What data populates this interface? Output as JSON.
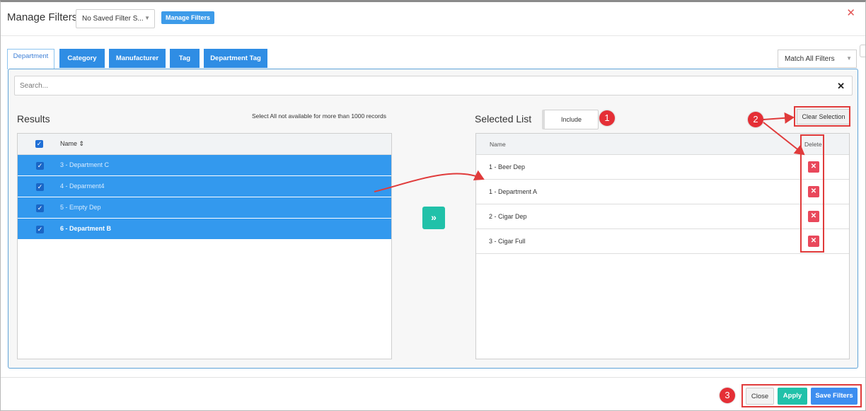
{
  "header": {
    "title": "Manage Filters",
    "saved_filter_value": "No Saved Filter S...",
    "manage_filters_label": "Manage Filters",
    "close_glyph": "✕"
  },
  "tabs": [
    {
      "label": "Department",
      "active": true
    },
    {
      "label": "Category",
      "active": false
    },
    {
      "label": "Manufacturer",
      "active": false
    },
    {
      "label": "Tag",
      "active": false
    },
    {
      "label": "Department Tag",
      "active": false
    }
  ],
  "match_select": {
    "value": "Match All Filters"
  },
  "search": {
    "placeholder": "Search...",
    "clear_glyph": "✕"
  },
  "results": {
    "title": "Results",
    "note": "Select All not available for more than 1000 records",
    "column_name": "Name",
    "rows": [
      {
        "label": "3 - Department C",
        "checked": true
      },
      {
        "label": "4 - Deparment4",
        "checked": true
      },
      {
        "label": "5 - Empty Dep",
        "checked": true
      },
      {
        "label": "6 - Department B",
        "checked": true
      }
    ]
  },
  "move_button": {
    "glyph": "»"
  },
  "selected": {
    "title": "Selected List",
    "include_label": "Include",
    "clear_label": "Clear Selection",
    "column_name": "Name",
    "column_delete": "Delete",
    "rows": [
      {
        "label": "1 - Beer Dep"
      },
      {
        "label": "1 - Department A"
      },
      {
        "label": "2 - Cigar Dep"
      },
      {
        "label": "3 - Cigar Full"
      }
    ]
  },
  "footer": {
    "close_label": "Close",
    "apply_label": "Apply",
    "save_label": "Save Filters"
  },
  "annotations": {
    "badges": [
      "1",
      "2",
      "3"
    ]
  },
  "colors": {
    "primary_blue": "#2f8de4",
    "row_selected": "#3399ee",
    "teal": "#21c1a9",
    "delete_red": "#e9485b",
    "annotation_red": "#e03b3b"
  }
}
